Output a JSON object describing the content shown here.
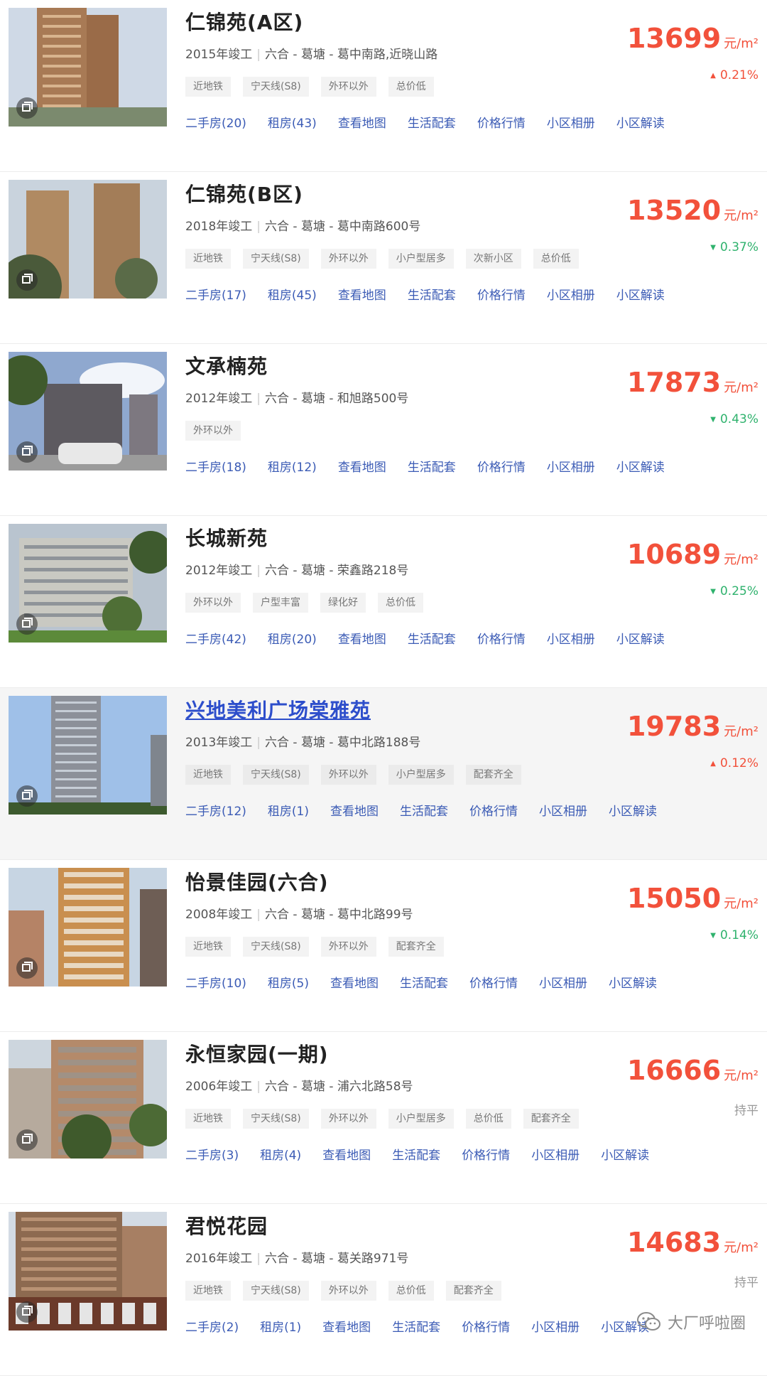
{
  "listings": [
    {
      "name": "仁锦苑(A区)",
      "year": "2015年竣工",
      "district": "六合",
      "area": "葛塘",
      "address": "葛中南路,近晓山路",
      "tags": [
        "近地铁",
        "宁天线(S8)",
        "外环以外",
        "总价低"
      ],
      "links": [
        "二手房(20)",
        "租房(43)",
        "查看地图",
        "生活配套",
        "价格行情",
        "小区相册",
        "小区解读"
      ],
      "price": "13699",
      "unit": "元/m²",
      "change": "0.21%",
      "trend": "up",
      "trend_icon": "triangle-up-icon"
    },
    {
      "name": "仁锦苑(B区)",
      "year": "2018年竣工",
      "district": "六合",
      "area": "葛塘",
      "address": "葛中南路600号",
      "tags": [
        "近地铁",
        "宁天线(S8)",
        "外环以外",
        "小户型居多",
        "次新小区",
        "总价低"
      ],
      "links": [
        "二手房(17)",
        "租房(45)",
        "查看地图",
        "生活配套",
        "价格行情",
        "小区相册",
        "小区解读"
      ],
      "price": "13520",
      "unit": "元/m²",
      "change": "0.37%",
      "trend": "down",
      "trend_icon": "triangle-down-icon"
    },
    {
      "name": "文承楠苑",
      "year": "2012年竣工",
      "district": "六合",
      "area": "葛塘",
      "address": "和旭路500号",
      "tags": [
        "外环以外"
      ],
      "links": [
        "二手房(18)",
        "租房(12)",
        "查看地图",
        "生活配套",
        "价格行情",
        "小区相册",
        "小区解读"
      ],
      "price": "17873",
      "unit": "元/m²",
      "change": "0.43%",
      "trend": "down",
      "trend_icon": "triangle-down-icon"
    },
    {
      "name": "长城新苑",
      "year": "2012年竣工",
      "district": "六合",
      "area": "葛塘",
      "address": "荣鑫路218号",
      "tags": [
        "外环以外",
        "户型丰富",
        "绿化好",
        "总价低"
      ],
      "links": [
        "二手房(42)",
        "租房(20)",
        "查看地图",
        "生活配套",
        "价格行情",
        "小区相册",
        "小区解读"
      ],
      "price": "10689",
      "unit": "元/m²",
      "change": "0.25%",
      "trend": "down",
      "trend_icon": "triangle-down-icon"
    },
    {
      "name": "兴地美利广场棠雅苑",
      "year": "2013年竣工",
      "district": "六合",
      "area": "葛塘",
      "address": "葛中北路188号",
      "tags": [
        "近地铁",
        "宁天线(S8)",
        "外环以外",
        "小户型居多",
        "配套齐全"
      ],
      "links": [
        "二手房(12)",
        "租房(1)",
        "查看地图",
        "生活配套",
        "价格行情",
        "小区相册",
        "小区解读"
      ],
      "price": "19783",
      "unit": "元/m²",
      "change": "0.12%",
      "trend": "up",
      "trend_icon": "triangle-up-icon"
    },
    {
      "name": "怡景佳园(六合)",
      "year": "2008年竣工",
      "district": "六合",
      "area": "葛塘",
      "address": "葛中北路99号",
      "tags": [
        "近地铁",
        "宁天线(S8)",
        "外环以外",
        "配套齐全"
      ],
      "links": [
        "二手房(10)",
        "租房(5)",
        "查看地图",
        "生活配套",
        "价格行情",
        "小区相册",
        "小区解读"
      ],
      "price": "15050",
      "unit": "元/m²",
      "change": "0.14%",
      "trend": "down",
      "trend_icon": "triangle-down-icon"
    },
    {
      "name": "永恒家园(一期)",
      "year": "2006年竣工",
      "district": "六合",
      "area": "葛塘",
      "address": "浦六北路58号",
      "tags": [
        "近地铁",
        "宁天线(S8)",
        "外环以外",
        "小户型居多",
        "总价低",
        "配套齐全"
      ],
      "links": [
        "二手房(3)",
        "租房(4)",
        "查看地图",
        "生活配套",
        "价格行情",
        "小区相册",
        "小区解读"
      ],
      "price": "16666",
      "unit": "元/m²",
      "change": "持平",
      "trend": "flat",
      "trend_icon": ""
    },
    {
      "name": "君悦花园",
      "year": "2016年竣工",
      "district": "六合",
      "area": "葛塘",
      "address": "葛关路971号",
      "tags": [
        "近地铁",
        "宁天线(S8)",
        "外环以外",
        "总价低",
        "配套齐全"
      ],
      "links": [
        "二手房(2)",
        "租房(1)",
        "查看地图",
        "生活配套",
        "价格行情",
        "小区相册",
        "小区解读"
      ],
      "price": "14683",
      "unit": "元/m²",
      "change": "持平",
      "trend": "flat",
      "trend_icon": ""
    }
  ],
  "highlighted_index": 4,
  "colors": {
    "price": "#f2513b",
    "up": "#f2513b",
    "down": "#2fb26d",
    "link": "#3b5bb5",
    "title_link": "#2d4ecb"
  },
  "watermark": {
    "text": "大厂呼啦圈",
    "icon": "wechat-icon"
  }
}
